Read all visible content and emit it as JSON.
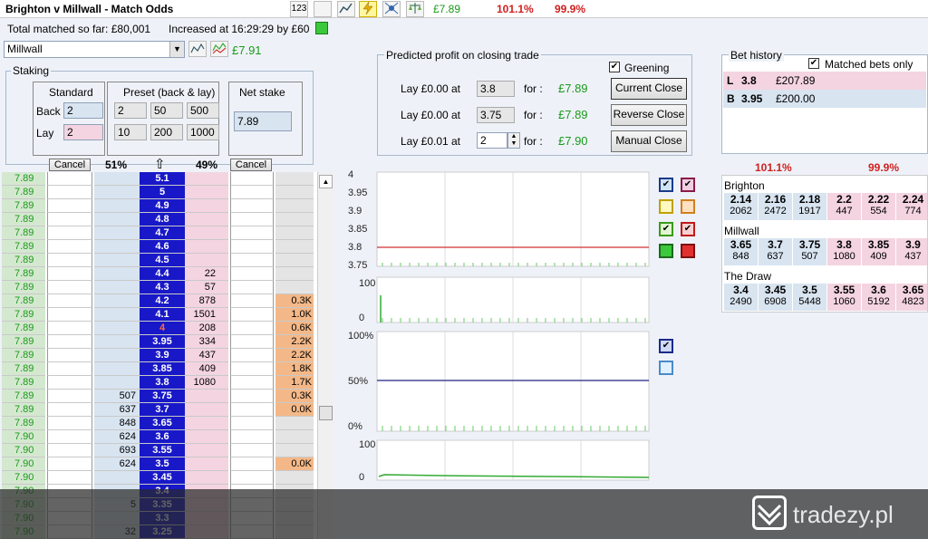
{
  "toolbar": {
    "title": "Brighton v Millwall - Match Odds",
    "icons": [
      "numbers-icon",
      "blank-icon",
      "chart-icon",
      "lightning-icon",
      "network-icon",
      "scales-icon"
    ],
    "icon_123": "123",
    "profit": "£7.89",
    "book_back": "101.1%",
    "book_lay": "99.9%"
  },
  "info": {
    "total_matched": "Total matched so far: £80,001",
    "increased": "Increased at 16:29:29 by £60"
  },
  "runner_select": {
    "value": "Millwall",
    "profit": "£7.91"
  },
  "staking": {
    "legend": "Staking",
    "standard_label": "Standard",
    "preset_label": "Preset (back & lay)",
    "net_label": "Net stake",
    "back_label": "Back",
    "lay_label": "Lay",
    "back_value": "2",
    "lay_value": "2",
    "preset_back": [
      "2",
      "50",
      "500"
    ],
    "preset_lay": [
      "10",
      "200",
      "1000"
    ],
    "net_value": "7.89"
  },
  "closing": {
    "legend": "Predicted profit on closing trade",
    "greening_label": "Greening",
    "greening_checked": "✔",
    "rows": [
      {
        "lay": "Lay  £0.00",
        "at": "at",
        "price": "3.8",
        "for": "for :",
        "profit": "£7.89",
        "button": "Current Close"
      },
      {
        "lay": "Lay  £0.00",
        "at": "at",
        "price": "3.75",
        "for": "for :",
        "profit": "£7.89",
        "button": "Reverse Close"
      },
      {
        "lay": "Lay  £0.01",
        "at": "at",
        "price": "2",
        "for": "for :",
        "profit": "£7.90",
        "button": "Manual Close"
      }
    ]
  },
  "bet_history": {
    "legend": "Bet history",
    "matched_only": "Matched bets only",
    "matched_checked": "✔",
    "bets": [
      {
        "side": "L",
        "price": "3.8",
        "amount": "£207.89"
      },
      {
        "side": "B",
        "price": "3.95",
        "amount": "£200.00"
      }
    ]
  },
  "ladder_header": {
    "cancel_left": "Cancel",
    "back_pct": "51%",
    "arrow": "⇧",
    "lay_pct": "49%",
    "cancel_right": "Cancel"
  },
  "ladder": [
    {
      "pl": "7.89",
      "bb": "",
      "price": "5.1",
      "ly": "",
      "tv": ""
    },
    {
      "pl": "7.89",
      "bb": "",
      "price": "5",
      "ly": "",
      "tv": ""
    },
    {
      "pl": "7.89",
      "bb": "",
      "price": "4.9",
      "ly": "",
      "tv": ""
    },
    {
      "pl": "7.89",
      "bb": "",
      "price": "4.8",
      "ly": "",
      "tv": ""
    },
    {
      "pl": "7.89",
      "bb": "",
      "price": "4.7",
      "ly": "",
      "tv": ""
    },
    {
      "pl": "7.89",
      "bb": "",
      "price": "4.6",
      "ly": "",
      "tv": ""
    },
    {
      "pl": "7.89",
      "bb": "",
      "price": "4.5",
      "ly": "",
      "tv": ""
    },
    {
      "pl": "7.89",
      "bb": "",
      "price": "4.4",
      "ly": "22",
      "tv": ""
    },
    {
      "pl": "7.89",
      "bb": "",
      "price": "4.3",
      "ly": "57",
      "tv": ""
    },
    {
      "pl": "7.89",
      "bb": "",
      "price": "4.2",
      "ly": "878",
      "tv": "0.3K"
    },
    {
      "pl": "7.89",
      "bb": "",
      "price": "4.1",
      "ly": "1501",
      "tv": "1.0K"
    },
    {
      "pl": "7.89",
      "bb": "",
      "price": "4",
      "ly": "208",
      "tv": "0.6K"
    },
    {
      "pl": "7.89",
      "bb": "",
      "price": "3.95",
      "ly": "334",
      "tv": "2.2K"
    },
    {
      "pl": "7.89",
      "bb": "",
      "price": "3.9",
      "ly": "437",
      "tv": "2.2K"
    },
    {
      "pl": "7.89",
      "bb": "",
      "price": "3.85",
      "ly": "409",
      "tv": "1.8K"
    },
    {
      "pl": "7.89",
      "bb": "",
      "price": "3.8",
      "ly": "1080",
      "tv": "1.7K"
    },
    {
      "pl": "7.89",
      "bb": "507",
      "price": "3.75",
      "ly": "",
      "tv": "0.3K"
    },
    {
      "pl": "7.89",
      "bb": "637",
      "price": "3.7",
      "ly": "",
      "tv": "0.0K"
    },
    {
      "pl": "7.89",
      "bb": "848",
      "price": "3.65",
      "ly": "",
      "tv": ""
    },
    {
      "pl": "7.90",
      "bb": "624",
      "price": "3.6",
      "ly": "",
      "tv": ""
    },
    {
      "pl": "7.90",
      "bb": "693",
      "price": "3.55",
      "ly": "",
      "tv": ""
    },
    {
      "pl": "7.90",
      "bb": "624",
      "price": "3.5",
      "ly": "",
      "tv": "0.0K"
    },
    {
      "pl": "7.90",
      "bb": "",
      "price": "3.45",
      "ly": "",
      "tv": ""
    },
    {
      "pl": "7.90",
      "bb": "",
      "price": "3.4",
      "ly": "",
      "tv": ""
    },
    {
      "pl": "7.90",
      "bb": "5",
      "price": "3.35",
      "ly": "",
      "tv": ""
    },
    {
      "pl": "7.90",
      "bb": "",
      "price": "3.3",
      "ly": "",
      "tv": ""
    },
    {
      "pl": "7.90",
      "bb": "32",
      "price": "3.25",
      "ly": "",
      "tv": ""
    }
  ],
  "price_chart": {
    "y_labels": [
      "4",
      "3.95",
      "3.9",
      "3.85",
      "3.8",
      "3.75"
    ],
    "line_color": "#d03030"
  },
  "volume_chart1": {
    "y_labels": [
      "100",
      "0"
    ]
  },
  "pct_chart": {
    "y_labels": [
      "100%",
      "50%",
      "0%"
    ],
    "line_color": "#202080"
  },
  "volume_chart2": {
    "y_labels": [
      "100",
      "0"
    ]
  },
  "right_market": {
    "back_total": "101.1%",
    "lay_total": "99.9%",
    "runners": [
      {
        "name": "Brighton",
        "prices": [
          "2.14",
          "2.16",
          "2.18",
          "2.2",
          "2.22",
          "2.24"
        ],
        "sizes": [
          "2062",
          "2472",
          "1917",
          "447",
          "554",
          "774"
        ]
      },
      {
        "name": "Millwall",
        "prices": [
          "3.65",
          "3.7",
          "3.75",
          "3.8",
          "3.85",
          "3.9"
        ],
        "sizes": [
          "848",
          "637",
          "507",
          "1080",
          "409",
          "437"
        ]
      },
      {
        "name": "The Draw",
        "prices": [
          "3.4",
          "3.45",
          "3.5",
          "3.55",
          "3.6",
          "3.65"
        ],
        "sizes": [
          "2490",
          "6908",
          "5448",
          "1060",
          "5192",
          "4823"
        ]
      }
    ]
  },
  "watermark": {
    "text": "tradezy.pl"
  }
}
